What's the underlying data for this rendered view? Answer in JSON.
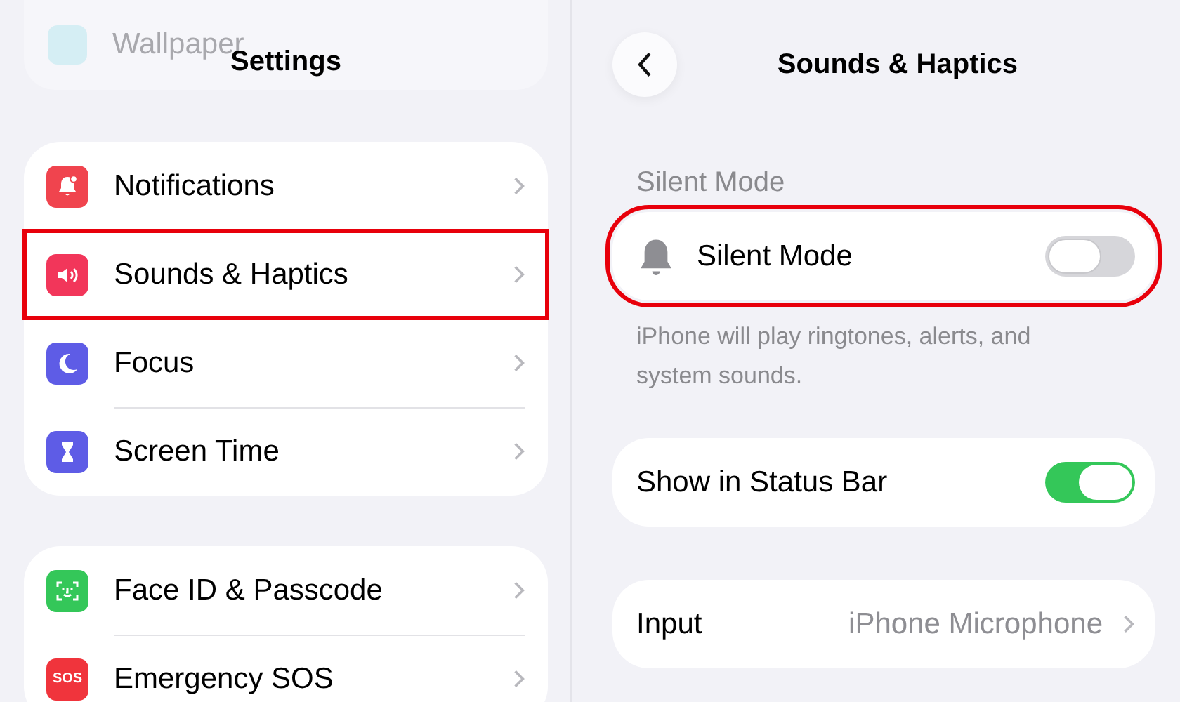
{
  "left_panel": {
    "faded_item": {
      "label": "Wallpaper"
    },
    "title": "Settings",
    "groups": [
      [
        {
          "kind": "bell",
          "color": "#f0444e",
          "label": "Notifications",
          "highlighted": false
        },
        {
          "kind": "speaker",
          "color": "#f2365a",
          "label": "Sounds & Haptics",
          "highlighted": true
        },
        {
          "kind": "moon",
          "color": "#5e5ce6",
          "label": "Focus",
          "highlighted": false
        },
        {
          "kind": "hourglass",
          "color": "#5e5ce6",
          "label": "Screen Time",
          "highlighted": false
        }
      ],
      [
        {
          "kind": "face",
          "color": "#34c759",
          "label": "Face ID & Passcode",
          "highlighted": false
        },
        {
          "kind": "sos",
          "color": "#f0343c",
          "label": "Emergency SOS",
          "icon_text": "SOS",
          "highlighted": false
        }
      ]
    ]
  },
  "right_panel": {
    "title": "Sounds & Haptics",
    "section_header": "Silent Mode",
    "cards": [
      {
        "kind": "toggle_with_bell",
        "label": "Silent Mode",
        "on": false,
        "highlighted": true,
        "footnote": "iPhone will play ringtones, alerts, and system sounds."
      },
      {
        "kind": "toggle",
        "label": "Show in Status Bar",
        "on": true,
        "highlighted": false
      },
      {
        "kind": "link",
        "label": "Input",
        "value": "iPhone Microphone",
        "highlighted": false
      }
    ]
  }
}
